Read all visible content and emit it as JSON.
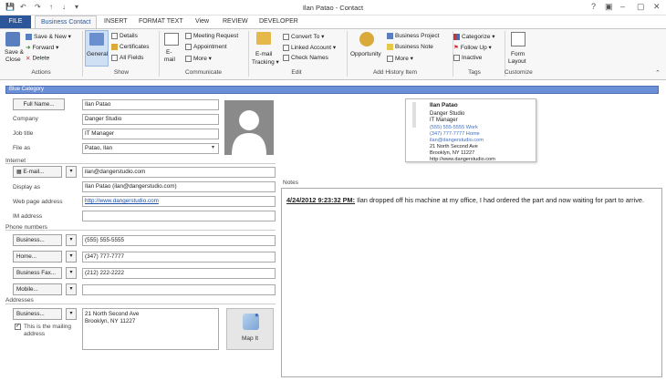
{
  "window": {
    "title": "Ilan Patao - Contact",
    "minimize": "–",
    "restore": "▢",
    "close": "✕",
    "help": "?",
    "ribbon_toggle": "▣"
  },
  "qat": {
    "save": "💾",
    "undo": "↶",
    "redo": "↷",
    "up": "↑",
    "down": "↓",
    "more": "▾"
  },
  "tabs": [
    "FILE",
    "Business Contact",
    "INSERT",
    "FORMAT TEXT",
    "View",
    "REVIEW",
    "DEVELOPER"
  ],
  "ribbon": {
    "actions": {
      "save_close": "Save &",
      "save_close2": "Close",
      "save_new": "Save & New",
      "forward": "Forward",
      "delete": "Delete",
      "label": "Actions"
    },
    "show": {
      "general": "General",
      "details": "Details",
      "certificates": "Certificates",
      "all_fields": "All Fields",
      "label": "Show"
    },
    "communicate": {
      "email": "E-",
      "email2": "mail",
      "meeting": "Meeting Request",
      "appointment": "Appointment",
      "more": "More",
      "label": "Communicate"
    },
    "edit": {
      "tracking": "E-mail",
      "tracking2": "Tracking",
      "convert": "Convert To",
      "linked": "Linked Account",
      "check": "Check Names",
      "label": "Edit"
    },
    "history": {
      "opportunity": "Opportunity",
      "project": "Business Project",
      "note": "Business Note",
      "more": "More",
      "label": "Add History Item"
    },
    "tags": {
      "categorize": "Categorize",
      "followup": "Follow Up",
      "inactive": "Inactive",
      "label": "Tags"
    },
    "customize": {
      "form": "Form",
      "form2": "Layout",
      "label": "Customize"
    }
  },
  "category": "Blue Category",
  "form": {
    "full_name_btn": "Full Name...",
    "full_name": "Ilan Patao",
    "company_label": "Company",
    "company": "Danger Studio",
    "job_label": "Job title",
    "job": "IT Manager",
    "fileas_label": "File as",
    "fileas": "Patao, Ilan",
    "internet_label": "Internet",
    "email_btn": "E-mail...",
    "email": "ilan@dangerstudio.com",
    "display_label": "Display as",
    "display": "Ilan Patao (ilan@dangerstudio.com)",
    "web_label": "Web page address",
    "web": "http://www.dangerstudio.com",
    "im_label": "IM address",
    "im": "",
    "phones_label": "Phone numbers",
    "phones": [
      {
        "btn": "Business...",
        "value": "(555) 555-5555"
      },
      {
        "btn": "Home...",
        "value": "(347) 777-7777"
      },
      {
        "btn": "Business Fax...",
        "value": "(212) 222-2222"
      },
      {
        "btn": "Mobile...",
        "value": ""
      }
    ],
    "addresses_label": "Addresses",
    "addr_btn": "Business...",
    "addr1": "21 North Second Ave",
    "addr2": "Brooklyn, NY 11227",
    "mailing": "This is the mailing",
    "mailing2": "address",
    "map": "Map It"
  },
  "card": {
    "name": "Ilan Patao",
    "company": "Danger Studio",
    "title": "IT Manager",
    "work": "(555) 555-5555 Work",
    "home": "(347) 777-7777 Home",
    "email": "ilan@dangerstudio.com",
    "street": "21 North Second Ave",
    "city": "Brooklyn, NY 11227",
    "web": "http://www.dangerstudio.com"
  },
  "notes": {
    "label": "Notes",
    "stamp": "4/24/2012 9:23:32 PM:",
    "text": " Ilan dropped off his machine at my office, I had ordered the part and now waiting for part to arrive."
  },
  "colors": {
    "file_tab": "#2b579a",
    "category": "#6b8fd6",
    "link": "#1a4ea8"
  }
}
